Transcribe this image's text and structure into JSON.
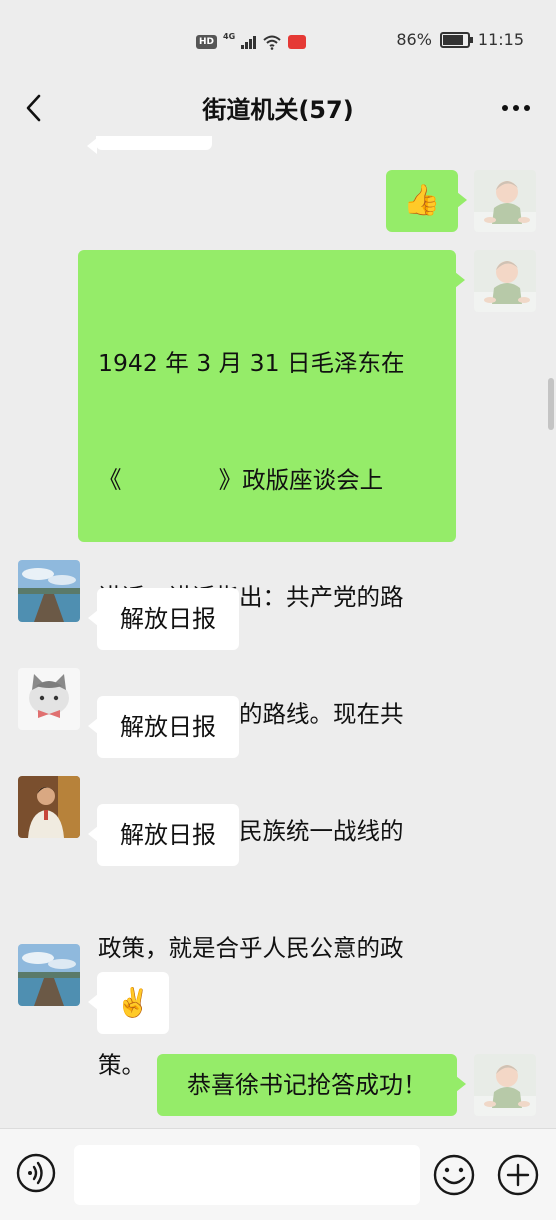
{
  "status_bar": {
    "network_badge": "HD",
    "network_type": "4G",
    "battery": "86%",
    "time": "11:15"
  },
  "header": {
    "title": "街道机关(57)",
    "back_icon": "chevron-left-icon",
    "more_icon": "ellipsis-icon"
  },
  "messages": [
    {
      "side": "right",
      "sender": "self",
      "type": "emoji",
      "emoji": "👍"
    },
    {
      "side": "right",
      "sender": "self",
      "type": "text",
      "lines": [
        "1942 年 3 月 31 日毛泽东在",
        "《             》政版座谈会上",
        "讲话。讲话指出：共产党的路",
        "线，就是人民的路线。现在共",
        "产党推行抗日民族统一战线的",
        "政策，就是合乎人民公意的政",
        "策。"
      ]
    },
    {
      "side": "left",
      "sender": "member-lake",
      "type": "text",
      "text": "解放日报"
    },
    {
      "side": "left",
      "sender": "member-cat",
      "type": "text",
      "text": "解放日报"
    },
    {
      "side": "left",
      "sender": "member-man",
      "type": "text",
      "text": "解放日报"
    },
    {
      "side": "left",
      "sender": "member-lake",
      "type": "emoji",
      "emoji": "✌️"
    },
    {
      "side": "right",
      "sender": "self",
      "type": "text",
      "text": "恭喜徐书记抢答成功！"
    }
  ],
  "input_bar": {
    "voice_icon": "voice-icon",
    "text_value": "",
    "emoji_icon": "smiley-icon",
    "plus_icon": "plus-icon"
  },
  "colors": {
    "background": "#ededed",
    "my_bubble": "#95ec69",
    "their_bubble": "#ffffff"
  }
}
